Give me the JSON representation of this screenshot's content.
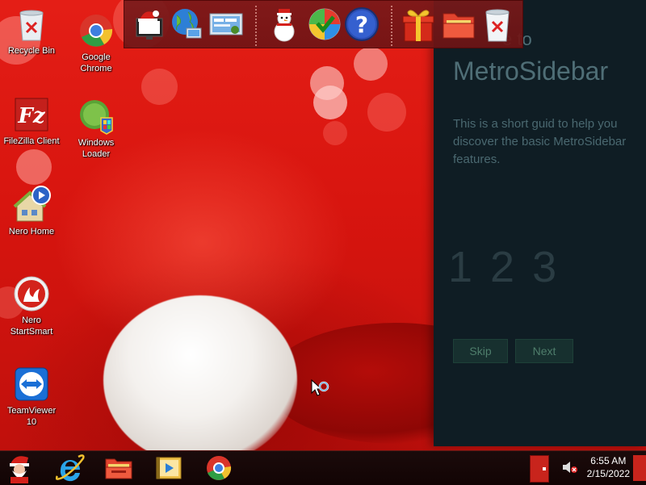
{
  "desktop": {
    "icons": [
      {
        "label": "Recycle Bin"
      },
      {
        "label": "Google\nChrome"
      },
      {
        "label": "FileZilla Client"
      },
      {
        "label": "Windows\nLoader"
      },
      {
        "label": "Nero Home"
      },
      {
        "label": "Nero\nStartSmart"
      },
      {
        "label": "TeamViewer\n10"
      }
    ]
  },
  "dock": {
    "items": [
      "santa-monitor-icon",
      "globe-network-icon",
      "control-panel-icon",
      "snowman-icon",
      "windows-update-icon",
      "help-icon",
      "gift-icon",
      "folder-icon",
      "recycle-bin-icon"
    ]
  },
  "metro": {
    "welcome": "e to",
    "title": "MetroSidebar",
    "description": "This is a short guid to help you discover the basic MetroSidebar features.",
    "steps": [
      "1",
      "2",
      "3"
    ],
    "skip_label": "Skip",
    "next_label": "Next"
  },
  "taskbar": {
    "items": [
      "start-santa-icon",
      "internet-explorer-icon",
      "file-explorer-icon",
      "media-player-icon",
      "chrome-icon"
    ],
    "time": "6:55 AM",
    "date": "2/15/2022"
  },
  "colors": {
    "wallpaper": "#d8150f",
    "metro_bg": "#0f1d24",
    "taskbar": "#140606"
  }
}
